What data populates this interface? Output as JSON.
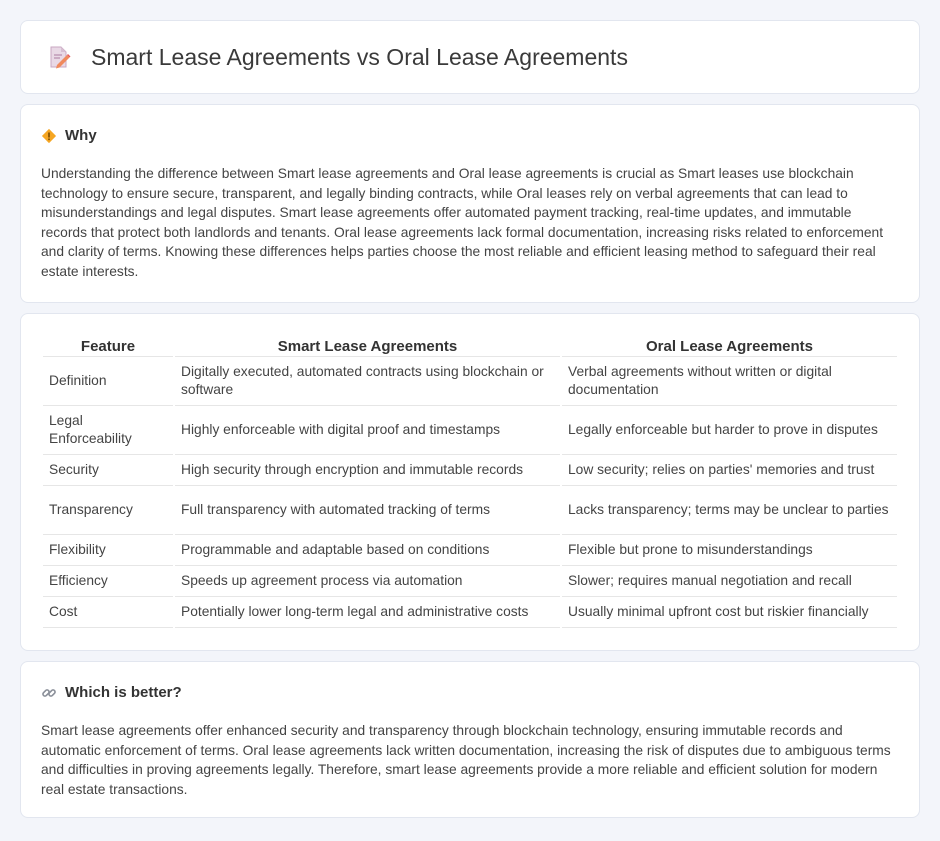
{
  "header": {
    "title": "Smart Lease Agreements vs Oral Lease Agreements",
    "icon": "document-pencil-icon"
  },
  "why": {
    "title": "Why",
    "icon": "diamond-sign-icon",
    "text": "Understanding the difference between Smart lease agreements and Oral lease agreements is crucial as Smart leases use blockchain technology to ensure secure, transparent, and legally binding contracts, while Oral leases rely on verbal agreements that can lead to misunderstandings and legal disputes. Smart lease agreements offer automated payment tracking, real-time updates, and immutable records that protect both landlords and tenants. Oral lease agreements lack formal documentation, increasing risks related to enforcement and clarity of terms. Knowing these differences helps parties choose the most reliable and efficient leasing method to safeguard their real estate interests."
  },
  "table": {
    "headers": [
      "Feature",
      "Smart Lease Agreements",
      "Oral Lease Agreements"
    ],
    "rows": [
      [
        "Definition",
        "Digitally executed, automated contracts using blockchain or software",
        "Verbal agreements without written or digital documentation"
      ],
      [
        "Legal Enforceability",
        "Highly enforceable with digital proof and timestamps",
        "Legally enforceable but harder to prove in disputes"
      ],
      [
        "Security",
        "High security through encryption and immutable records",
        "Low security; relies on parties' memories and trust"
      ],
      [
        "Transparency",
        "Full transparency with automated tracking of terms",
        "Lacks transparency; terms may be unclear to parties"
      ],
      [
        "Flexibility",
        "Programmable and adaptable based on conditions",
        "Flexible but prone to misunderstandings"
      ],
      [
        "Efficiency",
        "Speeds up agreement process via automation",
        "Slower; requires manual negotiation and recall"
      ],
      [
        "Cost",
        "Potentially lower long-term legal and administrative costs",
        "Usually minimal upfront cost but riskier financially"
      ]
    ]
  },
  "which": {
    "title": "Which is better?",
    "icon": "link-icon",
    "text": "Smart lease agreements offer enhanced security and transparency through blockchain technology, ensuring immutable records and automatic enforcement of terms. Oral lease agreements lack written documentation, increasing the risk of disputes due to ambiguous terms and difficulties in proving agreements legally. Therefore, smart lease agreements provide a more reliable and efficient solution for modern real estate transactions."
  }
}
